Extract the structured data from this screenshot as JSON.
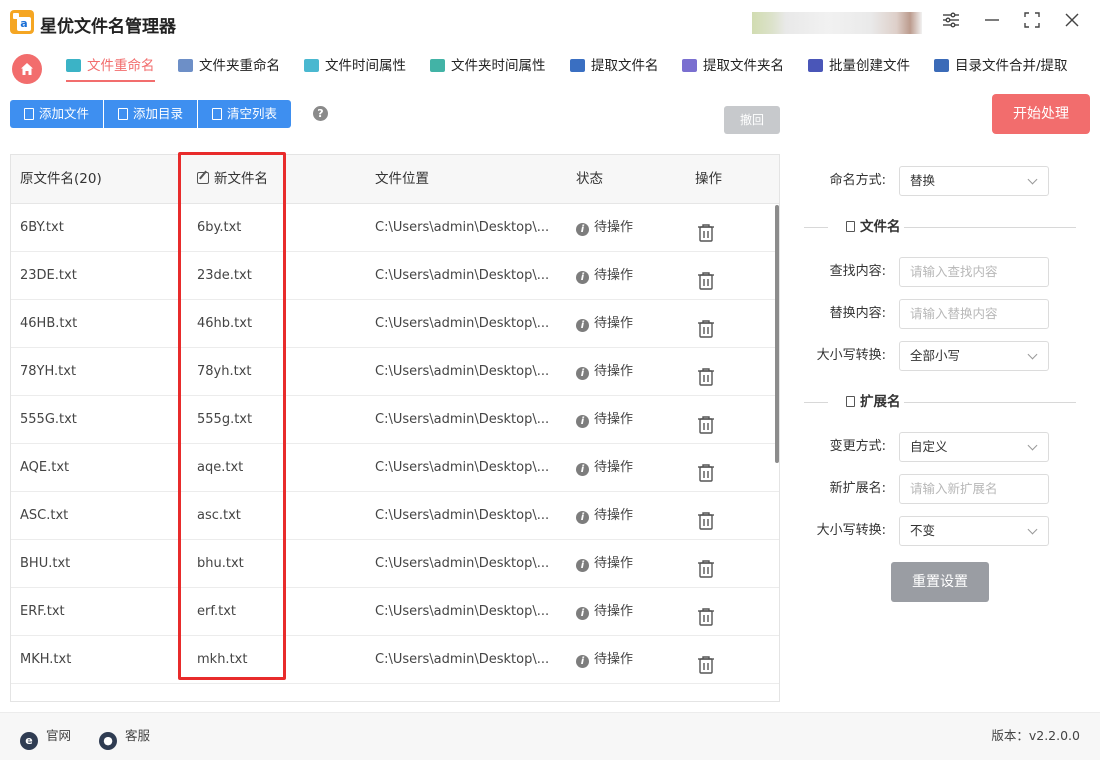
{
  "app": {
    "title": "星优文件名管理器",
    "window_controls": [
      "settings-icon",
      "minimize-icon",
      "maximize-icon",
      "close-icon"
    ]
  },
  "tabs": [
    {
      "label": "文件重命名",
      "active": true,
      "icon": "file-rename-icon",
      "color": "#3bb3c6"
    },
    {
      "label": "文件夹重命名",
      "active": false,
      "icon": "folder-rename-icon",
      "color": "#6d8fc7"
    },
    {
      "label": "文件时间属性",
      "active": false,
      "icon": "file-time-icon",
      "color": "#4ab8d0"
    },
    {
      "label": "文件夹时间属性",
      "active": false,
      "icon": "folder-time-icon",
      "color": "#42b3a6"
    },
    {
      "label": "提取文件名",
      "active": false,
      "icon": "extract-filename-icon",
      "color": "#3a6fc2"
    },
    {
      "label": "提取文件夹名",
      "active": false,
      "icon": "extract-foldername-icon",
      "color": "#7a6fd0"
    },
    {
      "label": "批量创建文件",
      "active": false,
      "icon": "batch-create-icon",
      "color": "#4a56b8"
    },
    {
      "label": "目录文件合并/提取",
      "active": false,
      "icon": "merge-extract-icon",
      "color": "#3b6bb8"
    }
  ],
  "toolbar": {
    "add_file": "添加文件",
    "add_dir": "添加目录",
    "clear_list": "清空列表",
    "help": "?",
    "undo": "撤回",
    "start": "开始处理"
  },
  "table": {
    "headers": {
      "original": "原文件名(20)",
      "new_name": "新文件名",
      "location": "文件位置",
      "status": "状态",
      "operation": "操作"
    },
    "rows": [
      {
        "original": "6BY.txt",
        "new_name": "6by.txt",
        "location": "C:\\Users\\admin\\Desktop\\...",
        "status": "待操作"
      },
      {
        "original": "23DE.txt",
        "new_name": "23de.txt",
        "location": "C:\\Users\\admin\\Desktop\\...",
        "status": "待操作"
      },
      {
        "original": "46HB.txt",
        "new_name": "46hb.txt",
        "location": "C:\\Users\\admin\\Desktop\\...",
        "status": "待操作"
      },
      {
        "original": "78YH.txt",
        "new_name": "78yh.txt",
        "location": "C:\\Users\\admin\\Desktop\\...",
        "status": "待操作"
      },
      {
        "original": "555G.txt",
        "new_name": "555g.txt",
        "location": "C:\\Users\\admin\\Desktop\\...",
        "status": "待操作"
      },
      {
        "original": "AQE.txt",
        "new_name": "aqe.txt",
        "location": "C:\\Users\\admin\\Desktop\\...",
        "status": "待操作"
      },
      {
        "original": "ASC.txt",
        "new_name": "asc.txt",
        "location": "C:\\Users\\admin\\Desktop\\...",
        "status": "待操作"
      },
      {
        "original": "BHU.txt",
        "new_name": "bhu.txt",
        "location": "C:\\Users\\admin\\Desktop\\...",
        "status": "待操作"
      },
      {
        "original": "ERF.txt",
        "new_name": "erf.txt",
        "location": "C:\\Users\\admin\\Desktop\\...",
        "status": "待操作"
      },
      {
        "original": "MKH.txt",
        "new_name": "mkh.txt",
        "location": "C:\\Users\\admin\\Desktop\\...",
        "status": "待操作"
      }
    ]
  },
  "settings": {
    "naming_mode_label": "命名方式:",
    "naming_mode_value": "替换",
    "filename_section": "文件名",
    "find_label": "查找内容:",
    "find_placeholder": "请输入查找内容",
    "replace_label": "替换内容:",
    "replace_placeholder": "请输入替换内容",
    "case_label": "大小写转换:",
    "case_value": "全部小写",
    "ext_section": "扩展名",
    "change_mode_label": "变更方式:",
    "change_mode_value": "自定义",
    "new_ext_label": "新扩展名:",
    "new_ext_placeholder": "请输入新扩展名",
    "ext_case_label": "大小写转换:",
    "ext_case_value": "不变",
    "reset": "重置设置"
  },
  "footer": {
    "website": "官网",
    "support": "客服",
    "version": "版本：v2.2.0.0"
  },
  "colors": {
    "accent_red": "#f26d6d",
    "button_blue": "#3e8ff0",
    "highlight_red": "#e82b2b"
  }
}
